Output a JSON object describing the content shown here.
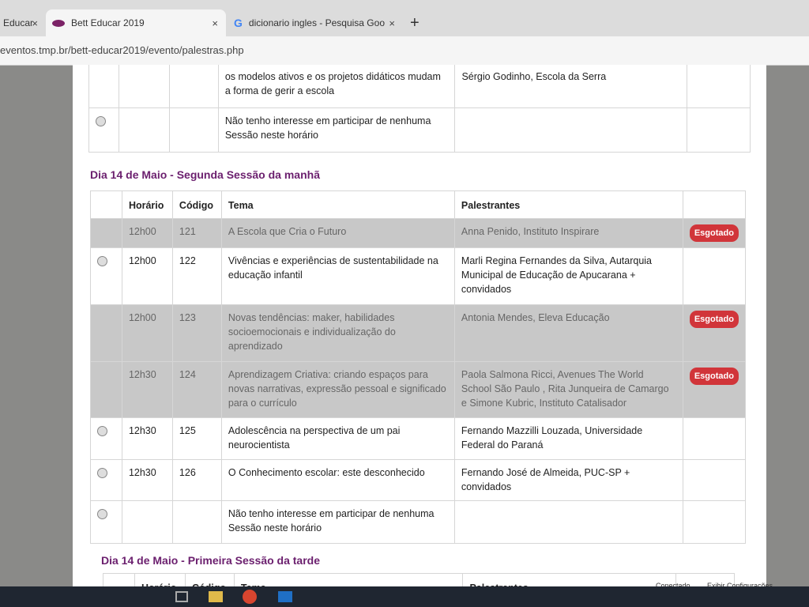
{
  "browser": {
    "tabs": [
      {
        "title": "Educar"
      },
      {
        "title": "Bett Educar 2019"
      },
      {
        "title": "dicionario ingles - Pesquisa Goo"
      }
    ],
    "new_tab_label": "+",
    "close_label": "×",
    "url": "eventos.tmp.br/bett-educar2019/evento/palestras.php"
  },
  "columns": {
    "horario": "Horário",
    "codigo": "Código",
    "tema": "Tema",
    "palestrantes": "Palestrantes"
  },
  "top_table": {
    "rows": [
      {
        "tema": "os modelos ativos e os projetos didáticos mudam a forma de gerir a escola",
        "palestrantes": "Sérgio Godinho, Escola da Serra"
      },
      {
        "tema": "Não tenho interesse em participar de nenhuma Sessão neste horário",
        "palestrantes": ""
      }
    ]
  },
  "section2": {
    "title": "Dia 14 de Maio - Segunda Sessão da manhã",
    "rows": [
      {
        "horario": "12h00",
        "codigo": "121",
        "tema": "A Escola que Cria o Futuro",
        "palestrantes": "Anna Penido, Instituto Inspirare",
        "status": "Esgotado"
      },
      {
        "horario": "12h00",
        "codigo": "122",
        "tema": "Vivências e experiências de sustentabilidade na educação infantil",
        "palestrantes": "Marli Regina Fernandes da Silva, Autarquia Municipal de Educação de Apucarana + convidados",
        "status": ""
      },
      {
        "horario": "12h00",
        "codigo": "123",
        "tema": "Novas tendências: maker, habilidades socioemocionais e individualização do aprendizado",
        "palestrantes": "Antonia Mendes, Eleva Educação",
        "status": "Esgotado"
      },
      {
        "horario": "12h30",
        "codigo": "124",
        "tema": "Aprendizagem Criativa: criando espaços para novas narrativas, expressão pessoal e significado para o currículo",
        "palestrantes": "Paola Salmona Ricci, Avenues The World School São Paulo , Rita Junqueira de Camargo e Simone Kubric, Instituto Catalisador",
        "status": "Esgotado"
      },
      {
        "horario": "12h30",
        "codigo": "125",
        "tema": "Adolescência na perspectiva de um pai neurocientista",
        "palestrantes": "Fernando Mazzilli Louzada, Universidade Federal do Paraná",
        "status": ""
      },
      {
        "horario": "12h30",
        "codigo": "126",
        "tema": "O Conhecimento escolar: este desconhecido",
        "palestrantes": "Fernando José de Almeida, PUC-SP + convidados",
        "status": ""
      },
      {
        "horario": "",
        "codigo": "",
        "tema": "Não tenho interesse em participar de nenhuma Sessão neste horário",
        "palestrantes": "",
        "status": ""
      }
    ]
  },
  "section3": {
    "title": "Dia 14 de Maio - Primeira Sessão da tarde"
  },
  "tray": {
    "status": "Conectado",
    "settings": "Exibir Configurações"
  }
}
